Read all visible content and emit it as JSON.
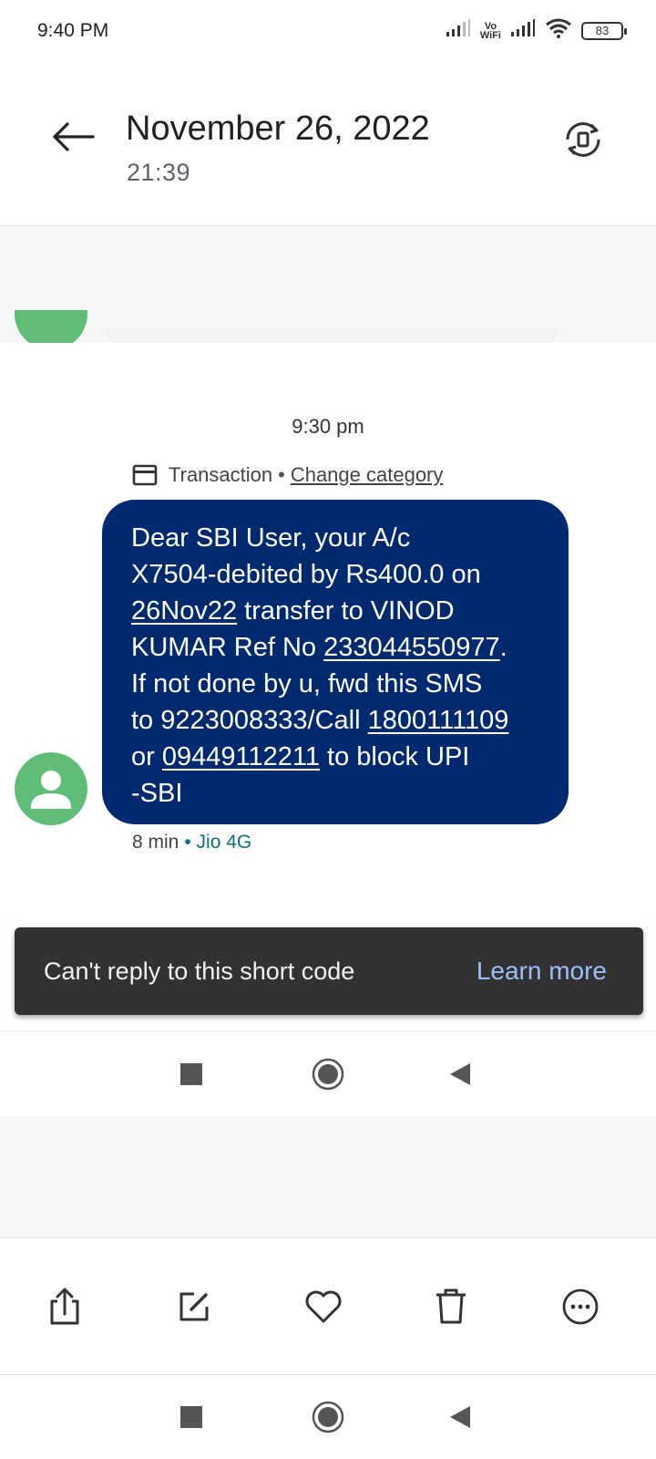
{
  "status_bar": {
    "time": "9:40 PM",
    "vowifi_top": "Vo",
    "vowifi_bottom": "WiFi",
    "battery": "83"
  },
  "header": {
    "title": "November 26, 2022",
    "subtitle": "21:39"
  },
  "message": {
    "timestamp": "9:30 pm",
    "category": "Transaction",
    "change_category": "Change category",
    "lines": {
      "l1": "Dear SBI User, your A/c",
      "l2": "X7504-debited by Rs400.0 on",
      "l3_link": "26Nov22",
      "l3_rest": " transfer to VINOD",
      "l4_start": "KUMAR Ref No ",
      "l4_link": "233044550977",
      "l4_end": ".",
      "l5": "If not done by u, fwd this SMS",
      "l6_start": "to 9223008333/Call ",
      "l6_link": "1800111109",
      "l7_start": "or ",
      "l7_link": "09449112211",
      "l7_end": " to block UPI",
      "l8": "-SBI"
    },
    "age": "8 min",
    "sim": "Jio 4G"
  },
  "snackbar": {
    "text": "Can't reply to this short code",
    "action": "Learn more"
  },
  "colors": {
    "bubble": "#002a6f",
    "avatar": "#5fbd78",
    "snackbar": "#323232",
    "snack_action": "#9bc0f5",
    "sim": "#0b6e80"
  }
}
